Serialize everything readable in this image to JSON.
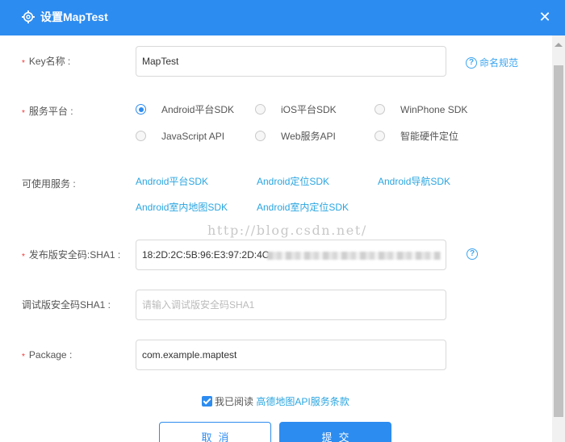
{
  "dialog": {
    "title": "设置MapTest",
    "close_glyph": "✕",
    "icon": "gear-icon"
  },
  "fields": {
    "key_name": {
      "label": "Key名称 :",
      "value": "MapTest",
      "help": "命名规范"
    },
    "platform": {
      "label": "服务平台 :",
      "options": [
        "Android平台SDK",
        "iOS平台SDK",
        "WinPhone SDK",
        "JavaScript API",
        "Web服务API",
        "智能硬件定位"
      ],
      "selected": "Android平台SDK"
    },
    "services": {
      "label": "可使用服务 :",
      "items": [
        "Android平台SDK",
        "Android定位SDK",
        "Android导航SDK",
        "Android室内地图SDK",
        "Android室内定位SDK"
      ]
    },
    "release_sha1": {
      "label": "发布版安全码:SHA1 :",
      "value": "18:2D:2C:5B:96:E3:97:2D:4C"
    },
    "debug_sha1": {
      "label": "调试版安全码SHA1 :",
      "placeholder": "请输入调试版安全码SHA1"
    },
    "package": {
      "label": "Package :",
      "value": "com.example.maptest"
    }
  },
  "required_mark": "*",
  "help_glyph": "?",
  "watermark": "http://blog.csdn.net/",
  "agreement": {
    "checked": true,
    "text": "我已阅读",
    "link": "高德地图API服务条款"
  },
  "buttons": {
    "cancel": "取消",
    "submit": "提交"
  },
  "colors": {
    "primary": "#2d8cf0",
    "link": "#2aa5e0",
    "required": "#ee3333"
  }
}
